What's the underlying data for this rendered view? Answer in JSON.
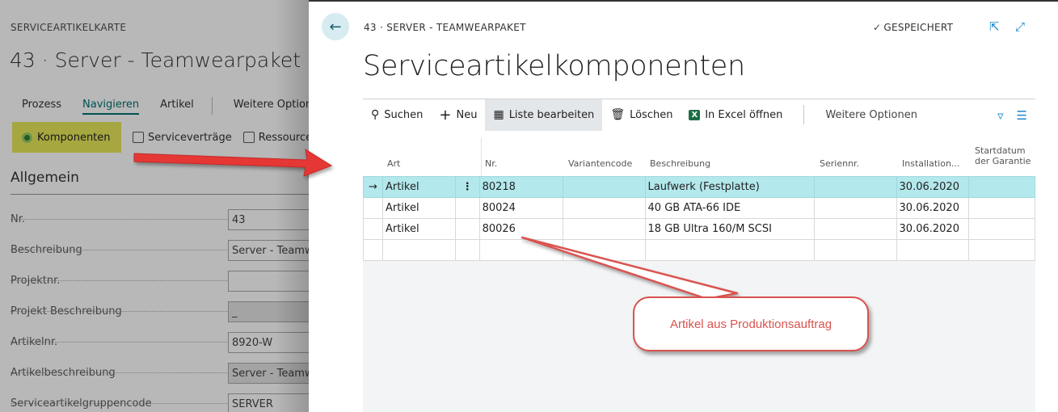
{
  "background_card": {
    "caption": "SERVICEARTIKELKARTE",
    "title": "43 · Server - Teamwearpaket",
    "tabs": [
      "Prozess",
      "Navigieren",
      "Artikel",
      "Weitere Optionen"
    ],
    "active_tab": "Navigieren",
    "actions": {
      "komponenten": "Komponenten",
      "servicevertraege": "Serviceverträge",
      "ressourcen": "Ressourcen"
    },
    "section": "Allgemein",
    "fields": [
      {
        "label": "Nr.",
        "value": "43",
        "readonly": false
      },
      {
        "label": "Beschreibung",
        "value": "Server - Teamwearpaket",
        "readonly": false
      },
      {
        "label": "Projektnr.",
        "value": "",
        "readonly": false
      },
      {
        "label": "Projekt Beschreibung",
        "value": "_",
        "readonly": true
      },
      {
        "label": "Artikelnr.",
        "value": "8920-W",
        "readonly": false
      },
      {
        "label": "Artikelbeschreibung",
        "value": "Server - Teamwearpaket",
        "readonly": true
      },
      {
        "label": "Serviceartikelgruppencode",
        "value": "SERVER",
        "readonly": false
      }
    ]
  },
  "dialog": {
    "caption": "43 · SERVER - TEAMWEARPAKET",
    "status": "GESPEICHERT",
    "title": "Serviceartikelkomponenten",
    "toolbar": {
      "search": "Suchen",
      "new": "Neu",
      "edit_list": "Liste bearbeiten",
      "delete": "Löschen",
      "excel": "In Excel öffnen",
      "more": "Weitere Optionen"
    },
    "columns": {
      "art": "Art",
      "nr": "Nr.",
      "variant": "Variantencode",
      "description": "Beschreibung",
      "serial": "Seriennr.",
      "installation": "Installation...",
      "warranty_1": "Startdatum",
      "warranty_2": "der Garantie"
    },
    "rows": [
      {
        "art": "Artikel",
        "nr": "80218",
        "variant": "",
        "description": "Laufwerk (Festplatte)",
        "serial": "",
        "installation": "30.06.2020",
        "warranty": "",
        "selected": true
      },
      {
        "art": "Artikel",
        "nr": "80024",
        "variant": "",
        "description": "40 GB ATA-66 IDE",
        "serial": "",
        "installation": "30.06.2020",
        "warranty": "",
        "selected": false
      },
      {
        "art": "Artikel",
        "nr": "80026",
        "variant": "",
        "description": "18 GB Ultra 160/M SCSI",
        "serial": "",
        "installation": "30.06.2020",
        "warranty": "",
        "selected": false
      },
      {
        "art": "",
        "nr": "",
        "variant": "",
        "description": "",
        "serial": "",
        "installation": "",
        "warranty": "",
        "selected": false
      }
    ]
  },
  "annotation": {
    "text": "Artikel aus Produktionsauftrag",
    "color": "#d9534f"
  },
  "colors": {
    "highlight_button": "#e8e85a",
    "selected_row": "#b3e8ec",
    "accent": "#00716f",
    "link_icon": "#1e88c8"
  }
}
